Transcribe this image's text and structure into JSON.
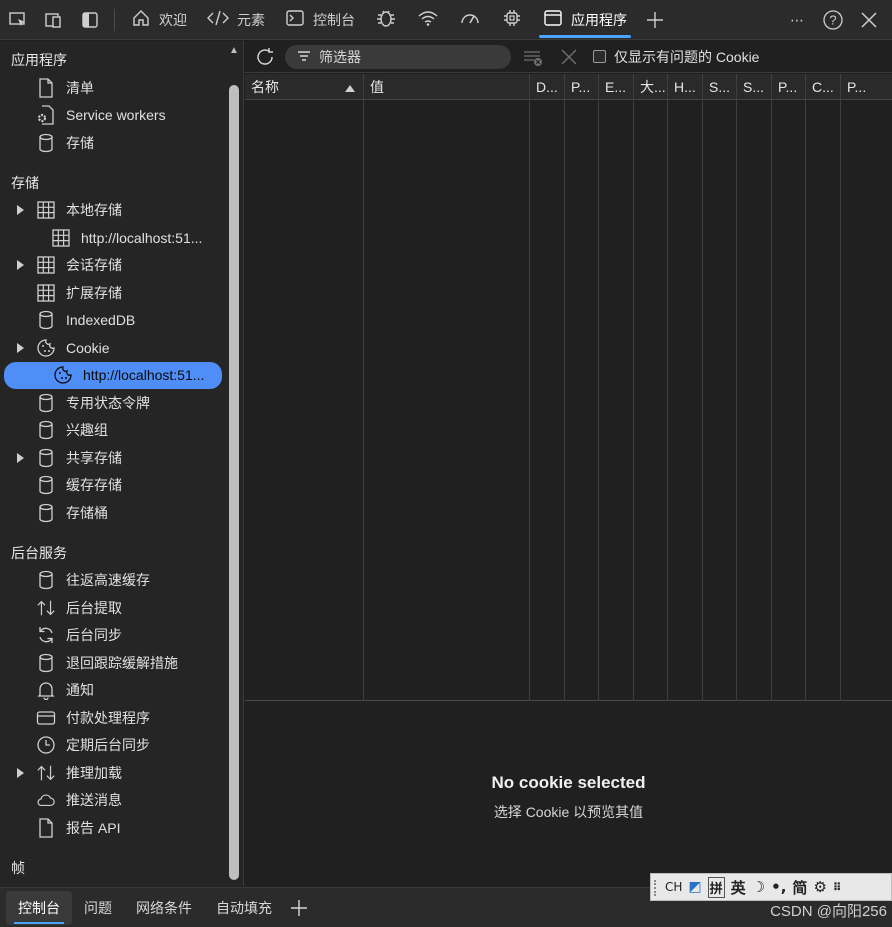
{
  "toolbar": {
    "tabs": [
      {
        "label": "欢迎",
        "icon": "home-icon"
      },
      {
        "label": "元素",
        "icon": "code-icon"
      },
      {
        "label": "控制台",
        "icon": "console-icon"
      },
      {
        "label": "",
        "icon": "bug-icon"
      },
      {
        "label": "",
        "icon": "wifi-icon"
      },
      {
        "label": "",
        "icon": "performance-gauge-icon"
      },
      {
        "label": "",
        "icon": "cpu-chip-icon"
      },
      {
        "label": "应用程序",
        "icon": "application-icon"
      }
    ],
    "more": "⋯",
    "help": "?",
    "close": "✕"
  },
  "sidebar": {
    "sections": [
      {
        "title": "应用程序",
        "items": [
          {
            "label": "清单",
            "icon": "document-icon"
          },
          {
            "label": "Service workers",
            "icon": "gear-document-icon"
          },
          {
            "label": "存储",
            "icon": "database-icon"
          }
        ]
      },
      {
        "title": "存储",
        "items": [
          {
            "label": "本地存储",
            "icon": "table-icon",
            "expandable": true
          },
          {
            "label": "http://localhost:51...",
            "icon": "table-icon",
            "indent": true
          },
          {
            "label": "会话存储",
            "icon": "table-icon",
            "expandable": true
          },
          {
            "label": "扩展存储",
            "icon": "table-icon"
          },
          {
            "label": "IndexedDB",
            "icon": "database-icon"
          },
          {
            "label": "Cookie",
            "icon": "cookie-icon",
            "expandable": true
          },
          {
            "label": "http://localhost:51...",
            "icon": "cookie-icon",
            "indent": true,
            "selected": true
          },
          {
            "label": "专用状态令牌",
            "icon": "database-icon"
          },
          {
            "label": "兴趣组",
            "icon": "database-icon"
          },
          {
            "label": "共享存储",
            "icon": "database-icon",
            "expandable": true
          },
          {
            "label": "缓存存储",
            "icon": "database-icon"
          },
          {
            "label": "存储桶",
            "icon": "database-icon"
          }
        ]
      },
      {
        "title": "后台服务",
        "items": [
          {
            "label": "往返高速缓存",
            "icon": "database-icon"
          },
          {
            "label": "后台提取",
            "icon": "up-down-arrows-icon"
          },
          {
            "label": "后台同步",
            "icon": "sync-icon"
          },
          {
            "label": "退回跟踪缓解措施",
            "icon": "database-icon"
          },
          {
            "label": "通知",
            "icon": "bell-icon"
          },
          {
            "label": "付款处理程序",
            "icon": "credit-card-icon"
          },
          {
            "label": "定期后台同步",
            "icon": "clock-icon"
          },
          {
            "label": "推理加载",
            "icon": "up-down-arrows-icon",
            "expandable": true
          },
          {
            "label": "推送消息",
            "icon": "cloud-icon"
          },
          {
            "label": "报告 API",
            "icon": "document-icon"
          }
        ]
      },
      {
        "title": "帧",
        "items": []
      }
    ]
  },
  "filter": {
    "placeholder": "筛选器",
    "only_issues_label": "仅显示有问题的 Cookie"
  },
  "table": {
    "columns": [
      "名称",
      "值",
      "D...",
      "P...",
      "E...",
      "大...",
      "H...",
      "S...",
      "S...",
      "P...",
      "C...",
      "P..."
    ]
  },
  "preview": {
    "title": "No cookie selected",
    "subtitle": "选择 Cookie 以预览其值"
  },
  "drawer": {
    "tabs": [
      "控制台",
      "问题",
      "网络条件",
      "自动填充"
    ],
    "add": "+"
  },
  "ime": {
    "items": [
      "CH",
      "拼",
      "英",
      "简"
    ]
  },
  "watermark": "CSDN @向阳256",
  "colors": {
    "accent": "#4aa3ff",
    "selected": "#4f8ef7"
  }
}
